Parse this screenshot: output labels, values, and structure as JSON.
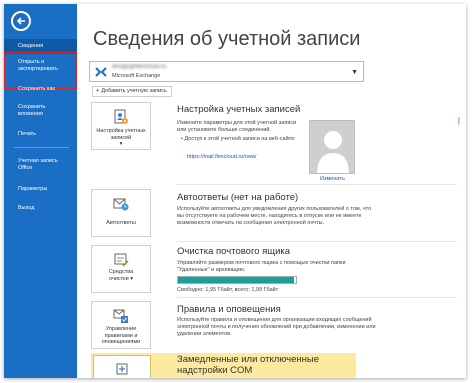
{
  "sidebar": {
    "items": [
      {
        "label": "Сведения"
      },
      {
        "label": "Открыть и экспортировать"
      },
      {
        "label": "Сохранить как"
      },
      {
        "label": "Сохранить вложения"
      },
      {
        "label": "Печать"
      },
      {
        "label": "Учетная запись Office"
      },
      {
        "label": "Параметры"
      },
      {
        "label": "Выход"
      }
    ]
  },
  "page": {
    "title": "Сведения об учетной записи"
  },
  "account": {
    "email": "dvsdjo@flexcloud.ru",
    "type": "Microsoft Exchange"
  },
  "add_account": "Добавить учетную запись",
  "sections": {
    "settings": {
      "tile": "Настройка учетных записей",
      "tile_caret": "▾",
      "title": "Настройка учетных записей",
      "desc1": "Измените параметры для этой учетной записи или установите больше соединений.",
      "bullet": "Доступ к этой учетной записи на веб-сайте:",
      "link": "https://mail.flexcloud.ru/owa/",
      "change_photo": "Изменить"
    },
    "autoreply": {
      "tile": "Автоответы",
      "title": "Автоответы (нет на работе)",
      "desc": "Используйте автоответы для уведомления других пользователей о том, что вы отсутствуете на рабочем месте, находитесь в отпуске или не имеете возможности отвечать на сообщения электронной почты."
    },
    "cleanup": {
      "tile1": "Средства",
      "tile2": "очистки",
      "tile_caret": "▾",
      "title": "Очистка почтового ящика",
      "desc": "Управляйте размером почтового ящика с помощью очистки папки \"Удаленные\" и архивацию.",
      "storage_text": "Свободно: 1,95 Гбайт, всего: 1,99 Гбайт",
      "used_fraction": 0.98
    },
    "rules": {
      "tile": "Управление правилами и оповещениями",
      "title": "Правила и оповещения",
      "desc": "Используйте правила и оповещения для организации входящих сообщений электронной почты и получения обновлений при добавлении, изменении или удалении элементов."
    },
    "com": {
      "title": "Замедленные или отключенные надстройки COM"
    }
  },
  "colors": {
    "sidebar": "#1a6fc4",
    "active": "#0f5aa7",
    "highlight": "#fbeaa0",
    "storage": "#1a9e9e"
  }
}
